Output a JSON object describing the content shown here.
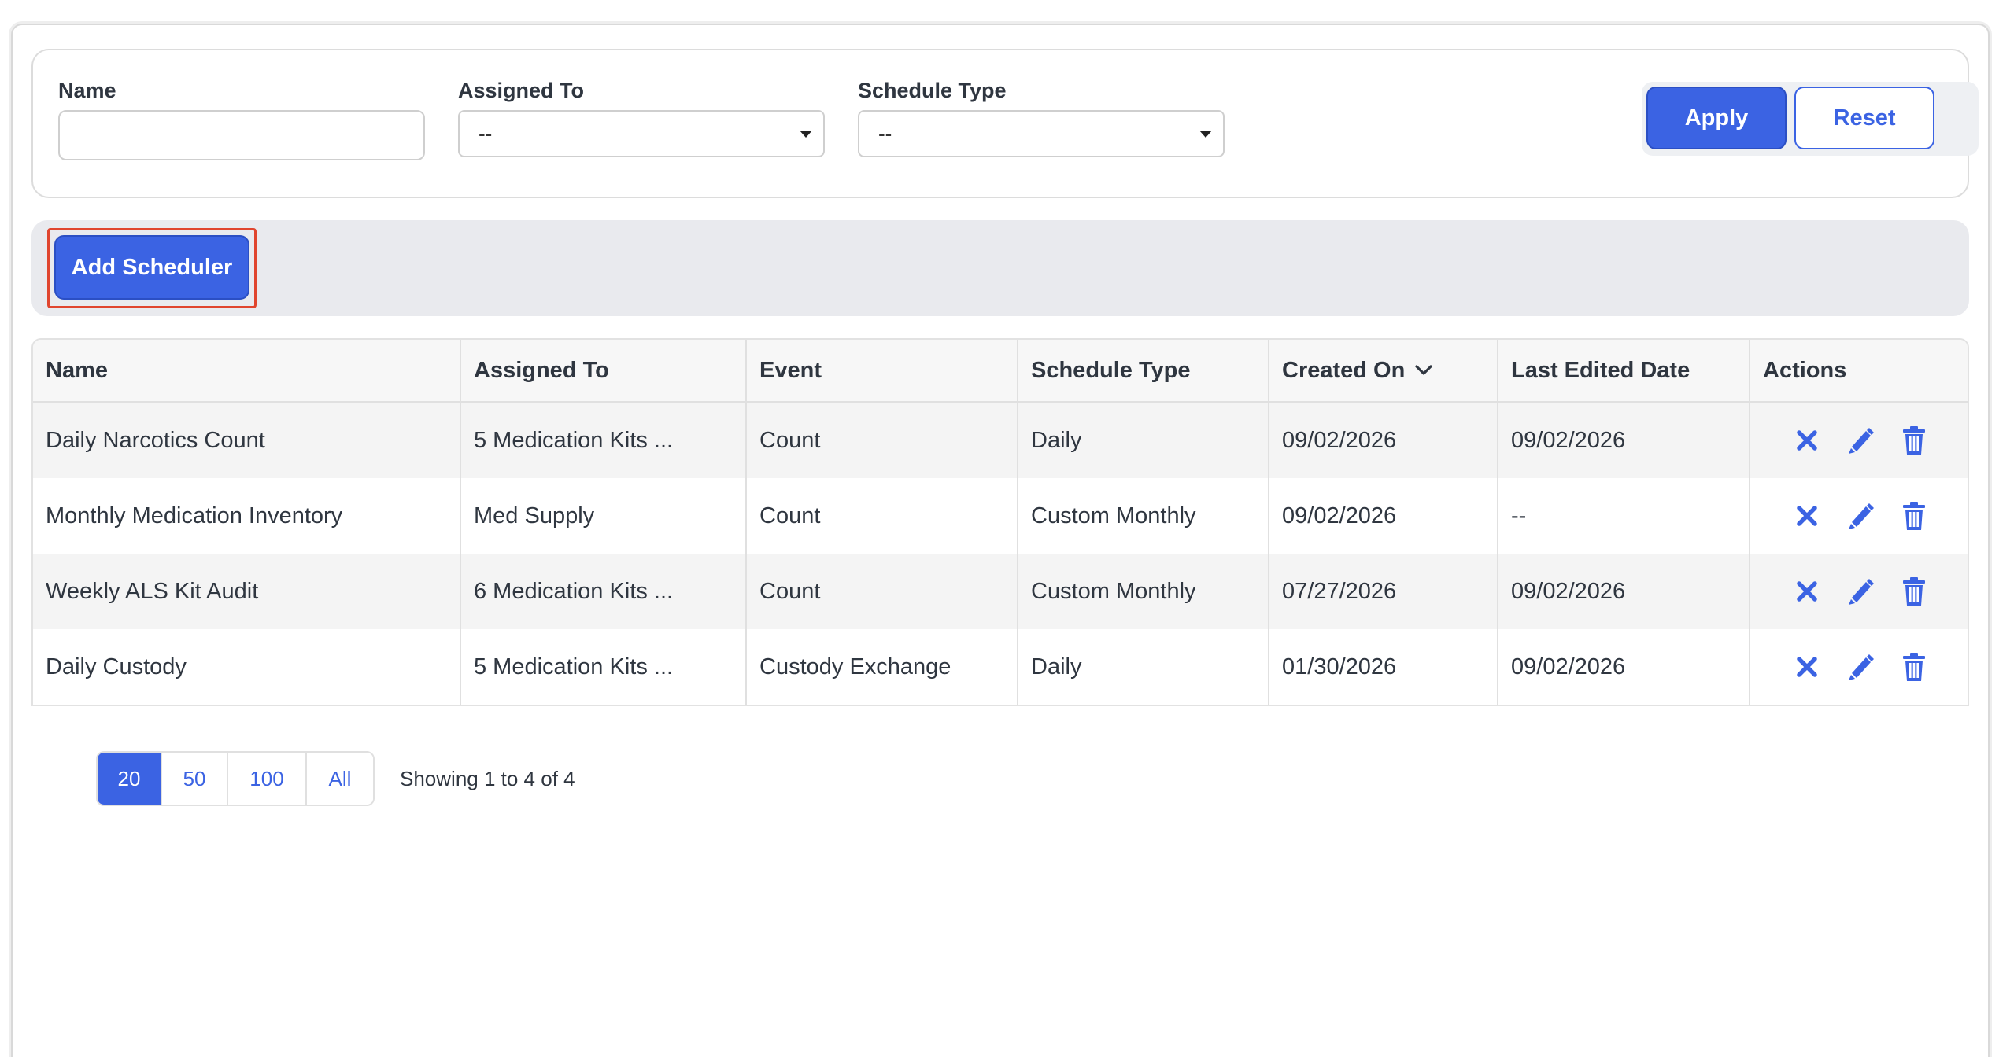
{
  "filters": {
    "name_label": "Name",
    "name_value": "",
    "assigned_to_label": "Assigned To",
    "assigned_to_value": "--",
    "schedule_type_label": "Schedule Type",
    "schedule_type_value": "--",
    "apply_label": "Apply",
    "reset_label": "Reset"
  },
  "toolbar": {
    "add_scheduler_label": "Add Scheduler"
  },
  "table": {
    "columns": [
      "Name",
      "Assigned To",
      "Event",
      "Schedule Type",
      "Created On",
      "Last Edited Date",
      "Actions"
    ],
    "sorted_column": "Created On",
    "rows": [
      [
        "Daily Narcotics Count",
        "5 Medication Kits ...",
        "Count",
        "Daily",
        "09/02/2026",
        "09/02/2026"
      ],
      [
        "Monthly Medication Inventory",
        "Med Supply",
        "Count",
        "Custom Monthly",
        "09/02/2026",
        "--"
      ],
      [
        "Weekly ALS Kit Audit",
        "6 Medication Kits ...",
        "Count",
        "Custom Monthly",
        "07/27/2026",
        "09/02/2026"
      ],
      [
        "Daily Custody",
        "5 Medication Kits ...",
        "Custody Exchange",
        "Daily",
        "01/30/2026",
        "09/02/2026"
      ]
    ],
    "action_icons": [
      "close-icon",
      "pencil-icon",
      "trash-icon"
    ]
  },
  "pagination": {
    "page_sizes": [
      "20",
      "50",
      "100",
      "All"
    ],
    "active_page_size": "20",
    "summary": "Showing 1 to 4 of 4"
  },
  "colors": {
    "accent": "#3b63e3",
    "highlight": "#e0452e"
  }
}
